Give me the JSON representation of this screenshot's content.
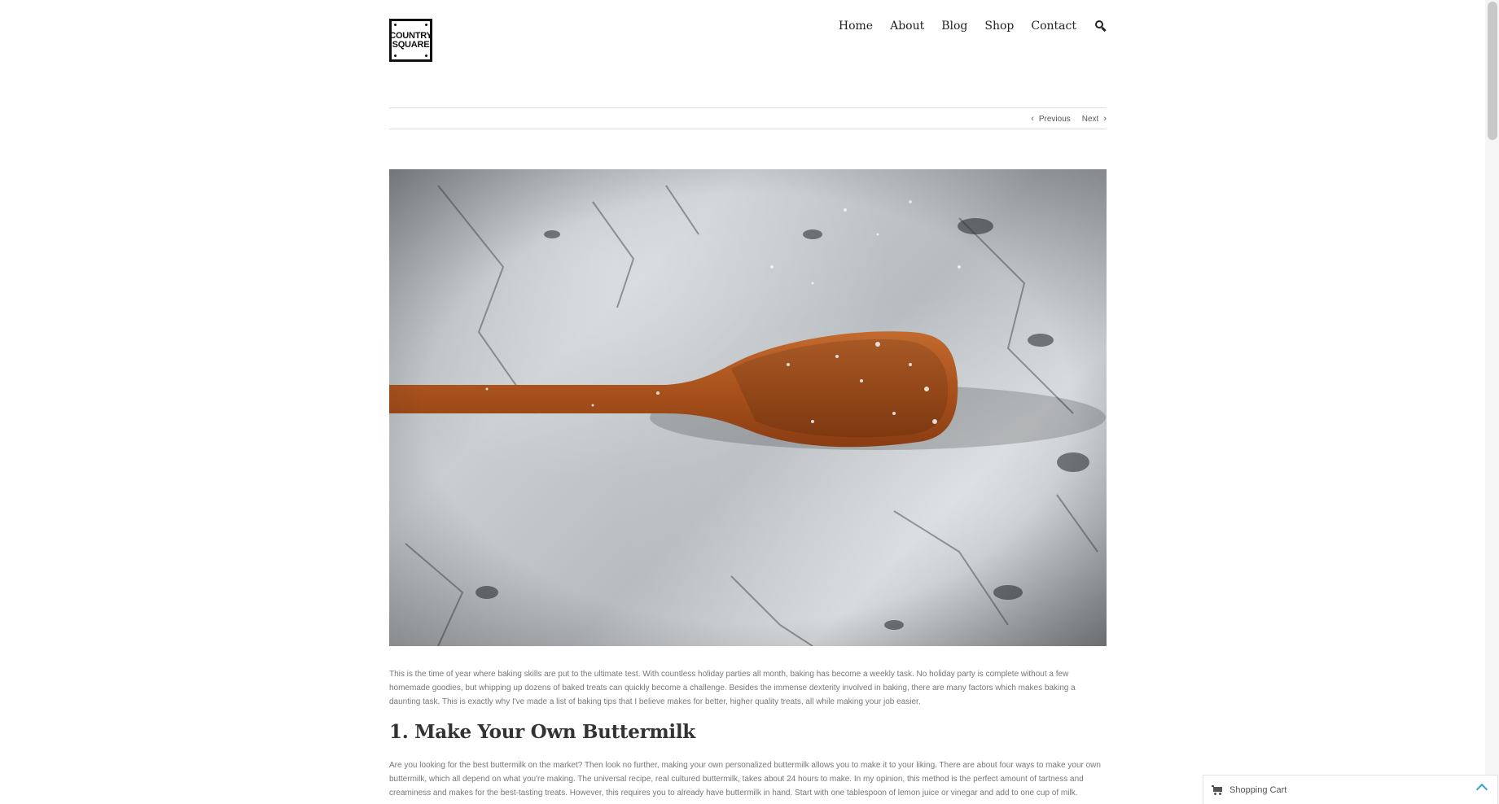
{
  "logo": {
    "line1": "COUNTRY",
    "line2": "SQUARE"
  },
  "nav": {
    "items": [
      "Home",
      "About",
      "Blog",
      "Shop",
      "Contact"
    ],
    "search_icon": "search-icon"
  },
  "post_nav": {
    "previous": "Previous",
    "next": "Next"
  },
  "hero": {
    "icon": "wooden-spoon-on-marble-photo"
  },
  "article": {
    "intro": "This is the time of year where baking skills are put to the ultimate test. With countless holiday parties all month, baking has become a weekly task. No holiday party is complete without a few homemade goodies, but whipping up dozens of baked treats can quickly become a challenge. Besides the immense dexterity involved in baking, there are many factors which makes baking a daunting task. This is exactly why I've made a list of baking tips that I believe makes for better, higher quality treats, all while making your job easier.",
    "heading1": "1. Make Your Own Buttermilk",
    "para1": "Are you looking for the best buttermilk on the market? Then look no further, making your own personalized buttermilk allows you to make it to your liking. There are about four ways to make your own buttermilk, which all depend on what you're making. The universal recipe, real cultured buttermilk, takes about 24 hours to make. In my opinion, this method is the perfect amount of tartness and creaminess and makes for the best-tasting treats. However, this requires you to already have buttermilk in hand. Start with one tablespoon of lemon juice or vinegar and add to one cup of milk."
  },
  "cart": {
    "label": "Shopping Cart"
  },
  "colors": {
    "accent": "#3aa3c9",
    "text": "#777777",
    "heading": "#333333"
  }
}
